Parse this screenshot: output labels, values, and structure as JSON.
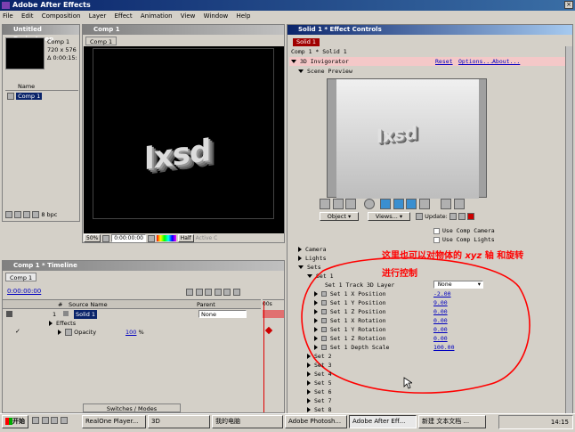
{
  "app": {
    "title": "Adobe After Effects"
  },
  "menubar": [
    "File",
    "Edit",
    "Composition",
    "Layer",
    "Effect",
    "Animation",
    "View",
    "Window",
    "Help"
  ],
  "project": {
    "title": "Untitled Project.aep",
    "comp_name": "Comp 1",
    "info_line1": "720 x 576",
    "info_line2": "Δ 0:00:15:",
    "col_name": "Name",
    "item": "Comp 1",
    "bpc": "8 bpc"
  },
  "comp_window": {
    "title": "Comp 1",
    "tab": "Comp 1",
    "zoom": "50%",
    "timecode": "0:00:00:00",
    "resolution": "Half",
    "camera": "Active C",
    "text3d": "lxsd"
  },
  "timeline": {
    "title": "Comp 1 * Timeline",
    "tab": "Comp 1",
    "timecode": "0:00:00:00",
    "col_num": "#",
    "col_source": "Source Name",
    "col_parent": "Parent",
    "ruler_start": "00s",
    "layer_num": "1",
    "layer_name": "Solid 1",
    "parent_value": "None",
    "effects_label": "Effects",
    "opacity_label": "Opacity",
    "opacity_value": "100",
    "opacity_unit": "%",
    "switches_modes": "Switches / Modes"
  },
  "effect_controls": {
    "title": "Solid 1 * Effect Controls",
    "tab": "Solid 1",
    "breadcrumb": "Comp 1 * Solid 1",
    "effect_name": "3D Invigorator",
    "reset_label": "Reset",
    "options_label": "Options...",
    "about_label": "About...",
    "scene_preview": "Scene Preview",
    "object_dropdown": "Object",
    "views_dropdown": "Views...",
    "update_label": "Update:",
    "use_comp_camera": "Use Comp Camera",
    "use_comp_lights": "Use Comp Lights",
    "camera": "Camera",
    "lights": "Lights",
    "sets": "Sets",
    "set1": "Set 1",
    "track_label": "Set 1 Track 3D Layer",
    "track_value": "None",
    "params": [
      {
        "label": "Set 1 X Position",
        "value": "-2.00"
      },
      {
        "label": "Set 1 Y Position",
        "value": "9.00"
      },
      {
        "label": "Set 1 Z Position",
        "value": "0.00"
      },
      {
        "label": "Set 1 X Rotation",
        "value": "0.00"
      },
      {
        "label": "Set 1 Y Rotation",
        "value": "0.00"
      },
      {
        "label": "Set 1 Z Rotation",
        "value": "0.00"
      },
      {
        "label": "Set 1 Depth Scale",
        "value": "100.00"
      }
    ],
    "other_sets": [
      "Set 2",
      "Set 3",
      "Set 4",
      "Set 5",
      "Set 6",
      "Set 7",
      "Set 8"
    ]
  },
  "annotation": {
    "line1_a": "这里也可以对物体的",
    "line1_b": "xyz",
    "line1_c": "轴 和旋转",
    "line2": "进行控制",
    "color": "#ff0000"
  },
  "taskbar": {
    "start": "开始",
    "items": [
      "RealOne Player...",
      "3D",
      "我的电脑",
      "Adobe Photosh...",
      "Adobe After Eff...",
      "新建 文本文档 ..."
    ],
    "clock": "14:15"
  },
  "colors": {
    "title_active": "#0a246a",
    "title_gradient_end": "#3a6ea5",
    "link_blue": "#0000c0",
    "annotation_red": "#ff0000"
  }
}
